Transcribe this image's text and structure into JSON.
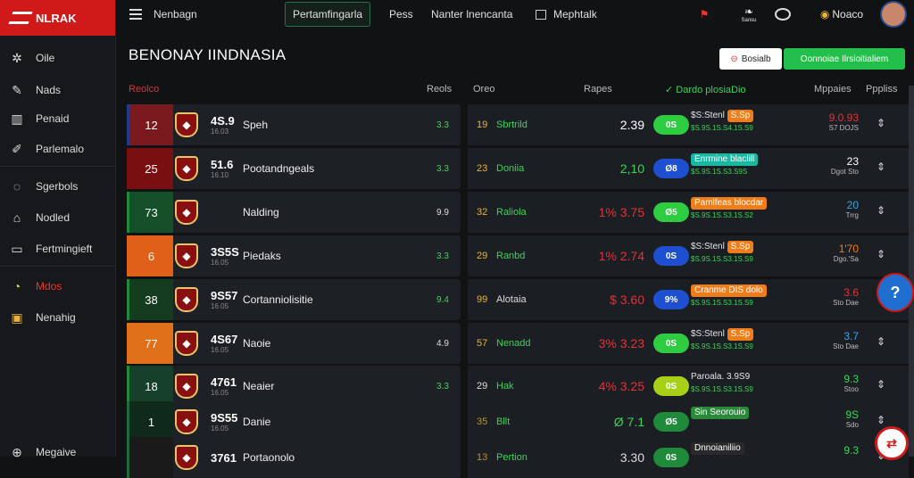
{
  "sidebar": {
    "logo": "NLRAK",
    "items": [
      {
        "label": "Oile",
        "icon": "compass-icon"
      },
      {
        "label": "Nads",
        "icon": "pen-icon"
      },
      {
        "label": "Penaid",
        "icon": "chart-icon"
      },
      {
        "label": "Parlemalo",
        "icon": "edit-icon"
      },
      {
        "label": "Sgerbols",
        "icon": "chat-icon"
      },
      {
        "label": "Nodled",
        "icon": "home-icon"
      },
      {
        "label": "Fertmingieft",
        "icon": "card-icon"
      },
      {
        "label": "Mdos",
        "icon": "ball-icon"
      },
      {
        "label": "Nenahig",
        "icon": "ticket-icon"
      },
      {
        "label": "Megaive",
        "icon": "globe-icon"
      }
    ]
  },
  "topbar": {
    "menu_label": "Nenbagn",
    "tabs": [
      "Pertamfingarla",
      "Pess",
      "Nanter lnencanta"
    ],
    "grid_label": "Mephtalk",
    "right_label": "Noaco",
    "badge_label": "Sansu"
  },
  "page": {
    "title": "BENONAY IINDNASIA",
    "btn_white": "Bosialb",
    "btn_green": "Oonnoiae Ilrsioitialiem"
  },
  "headers": {
    "col1": "Reolco",
    "col2": "Reols",
    "col3": "Oreo",
    "col4": "Rapes",
    "col5": "Dardo plosiaDio",
    "col6": "Mppaies",
    "col7": "Pppliss"
  },
  "rows": [
    {
      "rank": "12",
      "rank_color": "#7a1a1f",
      "stripe": "#1f3c8f",
      "big": "4S.9",
      "small": "16.03",
      "name": "Speh",
      "ls": "3.3",
      "ls_color": "#3bd45a",
      "rn": "19",
      "rn_color": "#e8b43a",
      "rteam": "Sbrtrild",
      "rteam_color": "#3bd45a",
      "odds": "2.39",
      "odds_color": "#ffffff",
      "pill": "0S",
      "pill_color": "#2ecc40",
      "mk": "$S:Stenl",
      "chip": "S.Sp",
      "chip_color": "#f07d1a",
      "sub": "$S.9S.1S.S4.1S.S9",
      "stat": "9.0.93",
      "stat_color": "#e0323a",
      "stat_sub": "S7 DOJS"
    },
    {
      "rank": "25",
      "rank_color": "#7a0f12",
      "stripe": "#7a0f12",
      "big": "51.6",
      "small": "16.10",
      "name": "Pootandngeals",
      "ls": "3.3",
      "ls_color": "#3bd45a",
      "rn": "23",
      "rn_color": "#e8b43a",
      "rteam": "Doniia",
      "rteam_color": "#3bd45a",
      "odds": "2,10",
      "odds_color": "#3bd45a",
      "pill": "Ø8",
      "pill_color": "#1e4fd0",
      "mk": "",
      "chip": "Enrmine blaclill",
      "chip_color": "#1ab8a0",
      "sub": "$S.9S.1S.S3.S9S",
      "stat": "23",
      "stat_color": "#ffffff",
      "stat_sub": "Dgot Sto"
    },
    {
      "rank": "73",
      "rank_color": "#16502a",
      "stripe": "#1e8a3a",
      "big": "",
      "small": "",
      "name": "Nalding",
      "ls": "9.9",
      "ls_color": "#dddddd",
      "rn": "32",
      "rn_color": "#e8b43a",
      "rteam": "Raliola",
      "rteam_color": "#3bd45a",
      "odds": "1% 3.75",
      "odds_color": "#e0323a",
      "pill": "Ø5",
      "pill_color": "#2ecc40",
      "mk": "",
      "chip": "Pamlfeas blocdar",
      "chip_color": "#f07d1a",
      "sub": "$S.9S.1S.S3.1S.S2",
      "stat": "20",
      "stat_color": "#3aa8e0",
      "stat_sub": "Trrg"
    },
    {
      "rank": "6",
      "rank_color": "#e0601a",
      "stripe": "#e0601a",
      "big": "3S5S",
      "small": "16.05",
      "name": "Piedaks",
      "ls": "3.3",
      "ls_color": "#3bd45a",
      "rn": "29",
      "rn_color": "#e8b43a",
      "rteam": "Ranbd",
      "rteam_color": "#3bd45a",
      "odds": "1% 2.74",
      "odds_color": "#e0323a",
      "pill": "0S",
      "pill_color": "#1e4fd0",
      "mk": "$S:Stenl",
      "chip": "S.Sp",
      "chip_color": "#f07d1a",
      "sub": "$S.9S.1S.S3.1S.S9",
      "stat": "1'70",
      "stat_color": "#f07d1a",
      "stat_sub": "Dgo.'Sa"
    },
    {
      "rank": "38",
      "rank_color": "#143c1e",
      "stripe": "#1e8a3a",
      "big": "9S57",
      "small": "16.05",
      "name": "Cortanniolisitie",
      "ls": "9.4",
      "ls_color": "#3bd45a",
      "rn": "99",
      "rn_color": "#e8b43a",
      "rteam": "Alotaia",
      "rteam_color": "#dddddd",
      "odds": "$ 3.60",
      "odds_color": "#e0323a",
      "pill": "9%",
      "pill_color": "#1e4fd0",
      "mk": "",
      "chip": "Cranme DIS dolo",
      "chip_color": "#f07d1a",
      "sub": "$S.9S.1S.S3.1S.S9",
      "stat": "3.6",
      "stat_color": "#e0323a",
      "stat_sub": "Sto Dae"
    },
    {
      "rank": "77",
      "rank_color": "#e0701a",
      "stripe": "#e0701a",
      "big": "4S67",
      "small": "16.05",
      "name": "Naoie",
      "ls": "4.9",
      "ls_color": "#dddddd",
      "rn": "57",
      "rn_color": "#e8b43a",
      "rteam": "Nenadd",
      "rteam_color": "#3bd45a",
      "odds": "3% 3.23",
      "odds_color": "#e0323a",
      "pill": "0S",
      "pill_color": "#2ecc40",
      "mk": "$S:Stenl",
      "chip": "S.Sp",
      "chip_color": "#f07d1a",
      "sub": "$S.9S.1S.S3.1S.S9",
      "stat": "3.7",
      "stat_color": "#3aa8e0",
      "stat_sub": "Sto Dae"
    },
    {
      "rank": "18",
      "rank_color": "#16402a",
      "stripe": "#1e8a3a",
      "big": "4761",
      "small": "16.05",
      "name": "Neaier",
      "ls": "3.3",
      "ls_color": "#3bd45a",
      "rn": "29",
      "rn_color": "#dddddd",
      "rteam": "Hak",
      "rteam_color": "#3bd45a",
      "odds": "4% 3.25",
      "odds_color": "#e0323a",
      "pill": "0S",
      "pill_color": "#a8d016",
      "mk": "Paroala. 3.9S9",
      "chip": "",
      "chip_color": "#f07d1a",
      "sub": "$S.9S.1S.S3.1S.S9",
      "stat": "9.3",
      "stat_color": "#3bd45a",
      "stat_sub": "Stoo"
    },
    {
      "rank": "1",
      "rank_color": "#0f2a1a",
      "stripe": "#1e6a3a",
      "big": "9S55",
      "small": "16.05",
      "name": "Danie",
      "ls": "",
      "ls_color": "#3bd45a",
      "rn": "35",
      "rn_color": "#b89030",
      "rteam": "Bllt",
      "rteam_color": "#3bd45a",
      "odds": "Ø 7.1",
      "odds_color": "#3bd45a",
      "pill": "Ø5",
      "pill_color": "#1e8a3a",
      "mk": "",
      "chip": "Sin Seorouio",
      "chip_color": "#2a8a3a",
      "sub": "",
      "stat": "9S",
      "stat_color": "#3bd45a",
      "stat_sub": "Sdo"
    },
    {
      "rank": "",
      "rank_color": "#1a1a1a",
      "stripe": "#1e6a3a",
      "big": "3761",
      "small": "",
      "name": "Portaonolo",
      "ls": "",
      "ls_color": "#3bd45a",
      "rn": "13",
      "rn_color": "#b89030",
      "rteam": "Pertion",
      "rteam_color": "#3bd45a",
      "odds": "3.30",
      "odds_color": "#dddddd",
      "pill": "0S",
      "pill_color": "#1e8a3a",
      "mk": "",
      "chip": "Dnnoianiliio",
      "chip_color": "#2a2a2a",
      "sub": "",
      "stat": "9.3",
      "stat_color": "#3bd45a",
      "stat_sub": ""
    }
  ]
}
